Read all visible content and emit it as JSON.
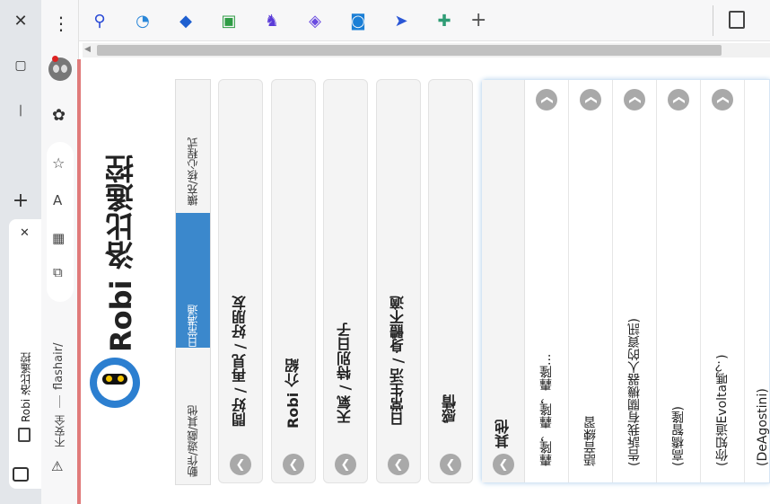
{
  "window": {
    "close_label": "✕",
    "maximize_label": "▢",
    "minimize_label": "—",
    "new_tab_label": "+"
  },
  "tab": {
    "title": "Robi 洛比遙控",
    "close_label": "✕"
  },
  "address": {
    "security_label": "不安全",
    "url": "flashair/"
  },
  "toolbar": {
    "more_label": "⋮",
    "add_label": "+",
    "extensions": [
      {
        "icon": "tool-icon",
        "color": "#2a4ad6"
      },
      {
        "icon": "chat-icon",
        "color": "#2a86d8"
      },
      {
        "icon": "tag-icon",
        "color": "#1e5fd0"
      },
      {
        "icon": "puzzle-icon",
        "color": "#2f9c45"
      },
      {
        "icon": "chess-icon",
        "color": "#5a3bd8"
      },
      {
        "icon": "loop-icon",
        "color": "#6a4be0"
      },
      {
        "icon": "camera-icon",
        "color": "#1b7fd6"
      },
      {
        "icon": "send-icon",
        "color": "#2a56d6"
      },
      {
        "icon": "game-icon",
        "color": "#2f9c75"
      }
    ]
  },
  "app": {
    "title": "Robi 洛比遙控",
    "tabs": [
      {
        "label": "動作/遊戲/其他",
        "active": false
      },
      {
        "label": "日常溝通",
        "active": true
      },
      {
        "label": "擴充/核心程式",
        "active": false
      }
    ],
    "categories": [
      {
        "label": "問好 / 再見 / 好朋友"
      },
      {
        "label": "Robi 介紹"
      },
      {
        "label": "天氣 / 特別日子"
      },
      {
        "label": "日常生活 / 身體不適"
      },
      {
        "label": "感情"
      }
    ],
    "expanded": {
      "label": "其他",
      "items": [
        {
          "label": "轟隆，轟隆，轟隆..."
        },
        {
          "label": "語音練習"
        },
        {
          "label": "(告訴我有關機器人的資訊)"
        },
        {
          "label": "(高橋智隆)"
        },
        {
          "label": "(你知道Evolta嗎？)"
        },
        {
          "label": "(DeAgostini)"
        }
      ]
    }
  }
}
